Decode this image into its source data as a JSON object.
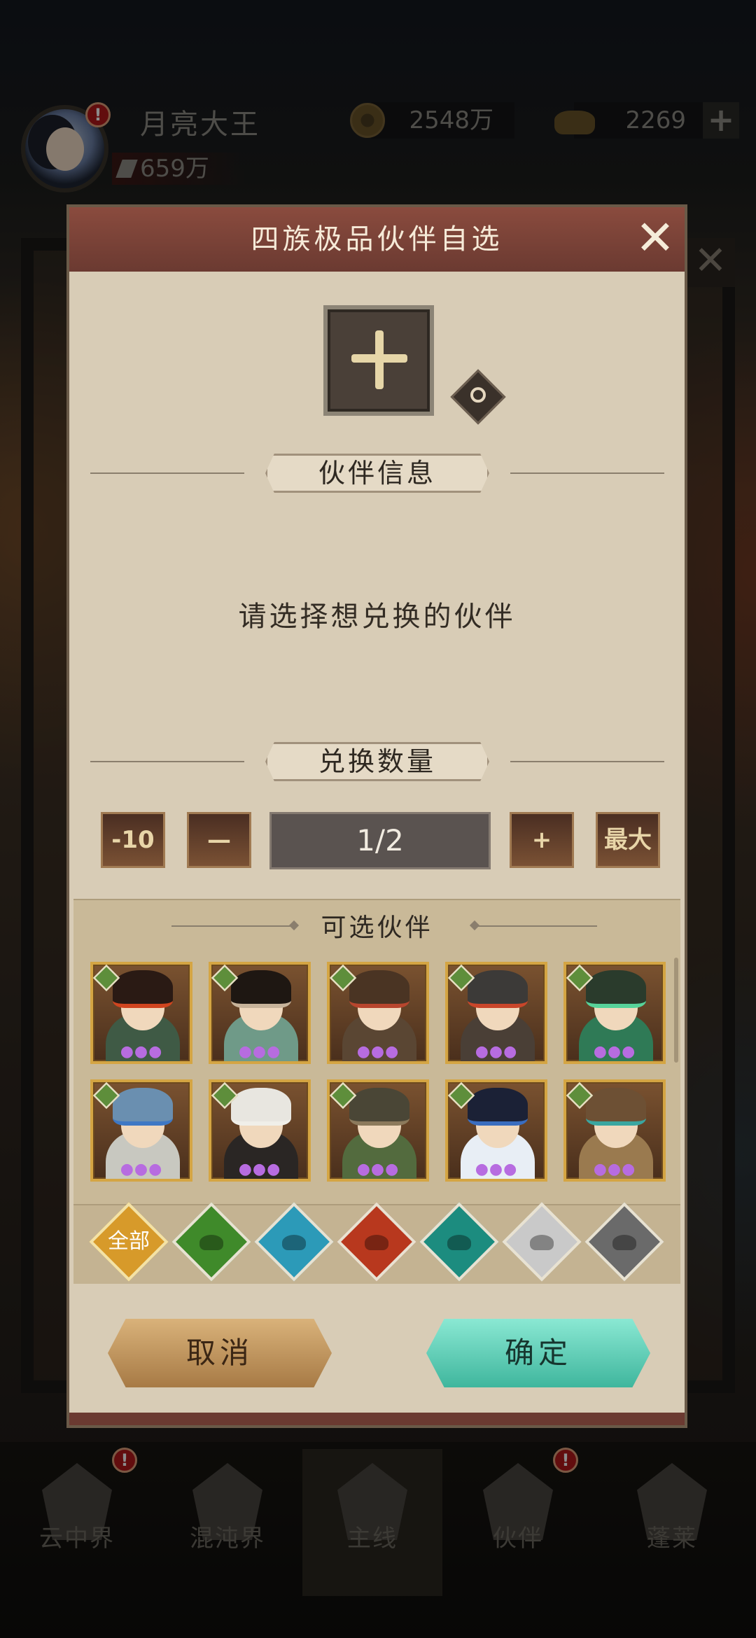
{
  "hud": {
    "player_name": "月亮大王",
    "power": "659万",
    "coins": "2548万",
    "ingots": "2269",
    "plus": "+",
    "badge": "!"
  },
  "background": {
    "close": "✕"
  },
  "modal": {
    "title": "四族极品伙伴自选",
    "close": "✕",
    "info_section": "伙伴信息",
    "prompt": "请选择想兑换的伙伴",
    "quantity_section": "兑换数量",
    "quantity": {
      "minus10": "-10",
      "minus": "—",
      "value": "1/2",
      "plus": "+",
      "max": "最大"
    },
    "partners_section": "可选伙伴",
    "partners": [
      {
        "hair": "#2a1a14",
        "outfit": "#3f5a45",
        "accent": "#d0451f"
      },
      {
        "hair": "#1e1712",
        "outfit": "#6f9a88",
        "accent": "#c7b39a"
      },
      {
        "hair": "#4a3423",
        "outfit": "#5a4633",
        "accent": "#b8462e"
      },
      {
        "hair": "#3c3a38",
        "outfit": "#4a3f36",
        "accent": "#c9462a"
      },
      {
        "hair": "#2a3b2c",
        "outfit": "#2f7a56",
        "accent": "#57d39a"
      },
      {
        "hair": "#6a8fb0",
        "outfit": "#c8c8c0",
        "accent": "#3e78c4"
      },
      {
        "hair": "#e8e6e0",
        "outfit": "#2a2624",
        "accent": "#f0efe9"
      },
      {
        "hair": "#4a4636",
        "outfit": "#536b3e",
        "accent": "#8c7a5c"
      },
      {
        "hair": "#1b2136",
        "outfit": "#e8eef5",
        "accent": "#3a6dbf"
      },
      {
        "hair": "#6d5034",
        "outfit": "#9a7a4f",
        "accent": "#3aa6a0"
      }
    ],
    "filters": [
      {
        "label": "全部",
        "color": "#d79a2a"
      },
      {
        "icon": "swallow-icon",
        "color": "#3f8a2a"
      },
      {
        "icon": "crane-icon",
        "color": "#2c9ab8"
      },
      {
        "icon": "fox-icon",
        "color": "#b8381e"
      },
      {
        "icon": "beast-icon",
        "color": "#1c8c7f"
      },
      {
        "icon": "dragon-white-icon",
        "color": "#c9c9c9"
      },
      {
        "icon": "dragon-dark-icon",
        "color": "#6a6a6a"
      }
    ],
    "cancel": "取消",
    "confirm": "确定"
  },
  "nav": [
    {
      "label": "云中界",
      "badge": true
    },
    {
      "label": "混沌界",
      "badge": false
    },
    {
      "label": "主线",
      "badge": false,
      "active": true
    },
    {
      "label": "伙伴",
      "badge": true
    },
    {
      "label": "蓬莱",
      "badge": false
    }
  ]
}
